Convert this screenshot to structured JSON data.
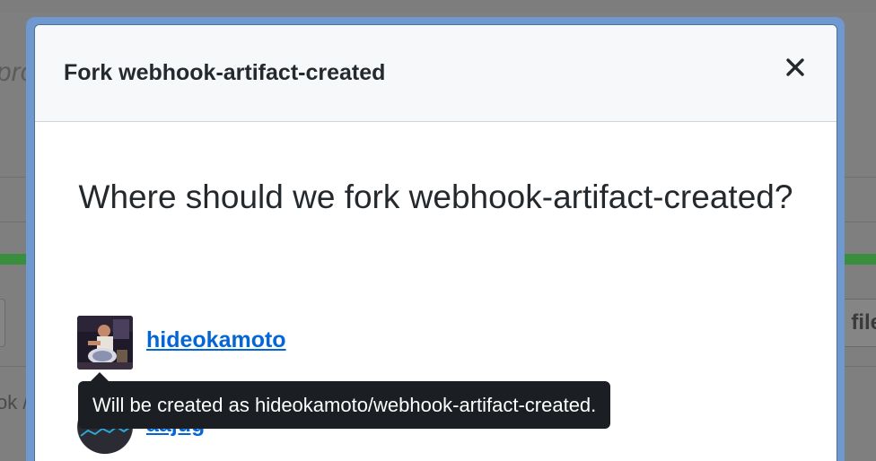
{
  "background": {
    "left_fragment_text": "pro",
    "right_button_label": "d file",
    "breadcrumb_fragment": "ok /"
  },
  "modal": {
    "title": "Fork webhook-artifact-created",
    "question": "Where should we fork webhook-artifact-created?",
    "owners": [
      {
        "name": "hideokamoto"
      },
      {
        "name": "aajug"
      }
    ],
    "tooltip": "Will be created as hideokamoto/webhook-artifact-created."
  },
  "icons": {
    "close": "close-icon"
  },
  "colors": {
    "link": "#0366d6",
    "tooltip_bg": "#1b1f23",
    "header_bg": "#f6f8fa",
    "focus_ring": "#6f98cf"
  }
}
